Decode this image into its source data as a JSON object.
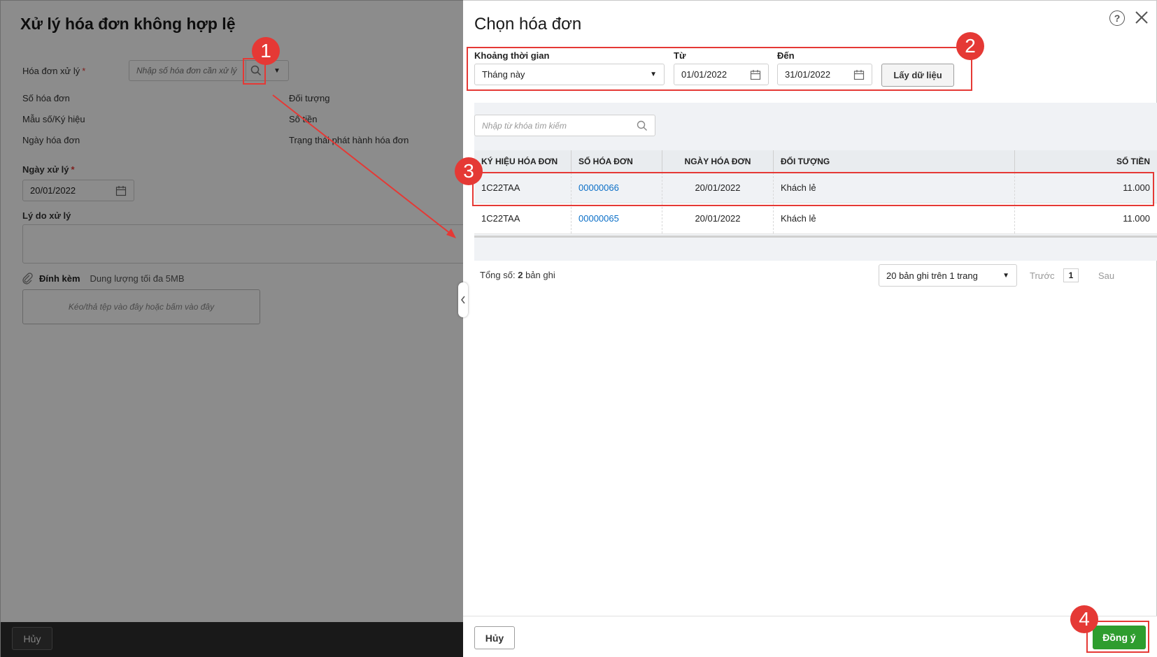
{
  "background_page": {
    "title": "Xử lý hóa đơn không hợp lệ",
    "invoice_label": "Hóa đơn xử lý",
    "required_mark": "*",
    "invoice_placeholder": "Nhập số hóa đơn cần xử lý",
    "fields": {
      "invoice_number": "Số hóa đơn",
      "form_symbol": "Mẫu số/Ký hiệu",
      "invoice_date": "Ngày hóa đơn",
      "customer": "Đối tượng",
      "amount": "Số tiền",
      "status": "Trạng thái phát hành hóa đơn"
    },
    "process_date_label": "Ngày xử lý",
    "process_date_value": "20/01/2022",
    "reason_label": "Lý do xử lý",
    "attachment_label": "Đính kèm",
    "attachment_note": "Dung lượng tối đa 5MB",
    "drop_hint": "Kéo/thả tệp vào đây hoặc bấm vào đây",
    "cancel_label": "Hủy"
  },
  "dialog": {
    "title": "Chọn hóa đơn",
    "period_label": "Khoảng thời gian",
    "period_value": "Tháng này",
    "from_label": "Từ",
    "from_value": "01/01/2022",
    "to_label": "Đến",
    "to_value": "31/01/2022",
    "fetch_label": "Lấy dữ liệu",
    "search_placeholder": "Nhập từ khóa tìm kiếm",
    "columns": [
      "KÝ HIỆU HÓA ĐƠN",
      "SỐ HÓA ĐƠN",
      "NGÀY HÓA ĐƠN",
      "ĐỐI TƯỢNG",
      "SỐ TIỀN"
    ],
    "rows": [
      {
        "symbol": "1C22TAA",
        "number": "00000066",
        "date": "20/01/2022",
        "customer": "Khách lẻ",
        "amount": "11.000"
      },
      {
        "symbol": "1C22TAA",
        "number": "00000065",
        "date": "20/01/2022",
        "customer": "Khách lẻ",
        "amount": "11.000"
      }
    ],
    "total_prefix": "Tổng số:",
    "total_count": "2",
    "total_suffix": "bản ghi",
    "page_size": "20 bản ghi trên 1 trang",
    "prev_label": "Trước",
    "current_page": "1",
    "next_label": "Sau",
    "cancel_label": "Hủy",
    "ok_label": "Đồng ý"
  },
  "annotations": {
    "step1": "1",
    "step2": "2",
    "step3": "3",
    "step4": "4",
    "color": "#e53935"
  },
  "colors": {
    "link": "#0b6fc7",
    "primary_button": "#2e9d2e",
    "overlay": "rgba(0,0,0,0.45)"
  }
}
